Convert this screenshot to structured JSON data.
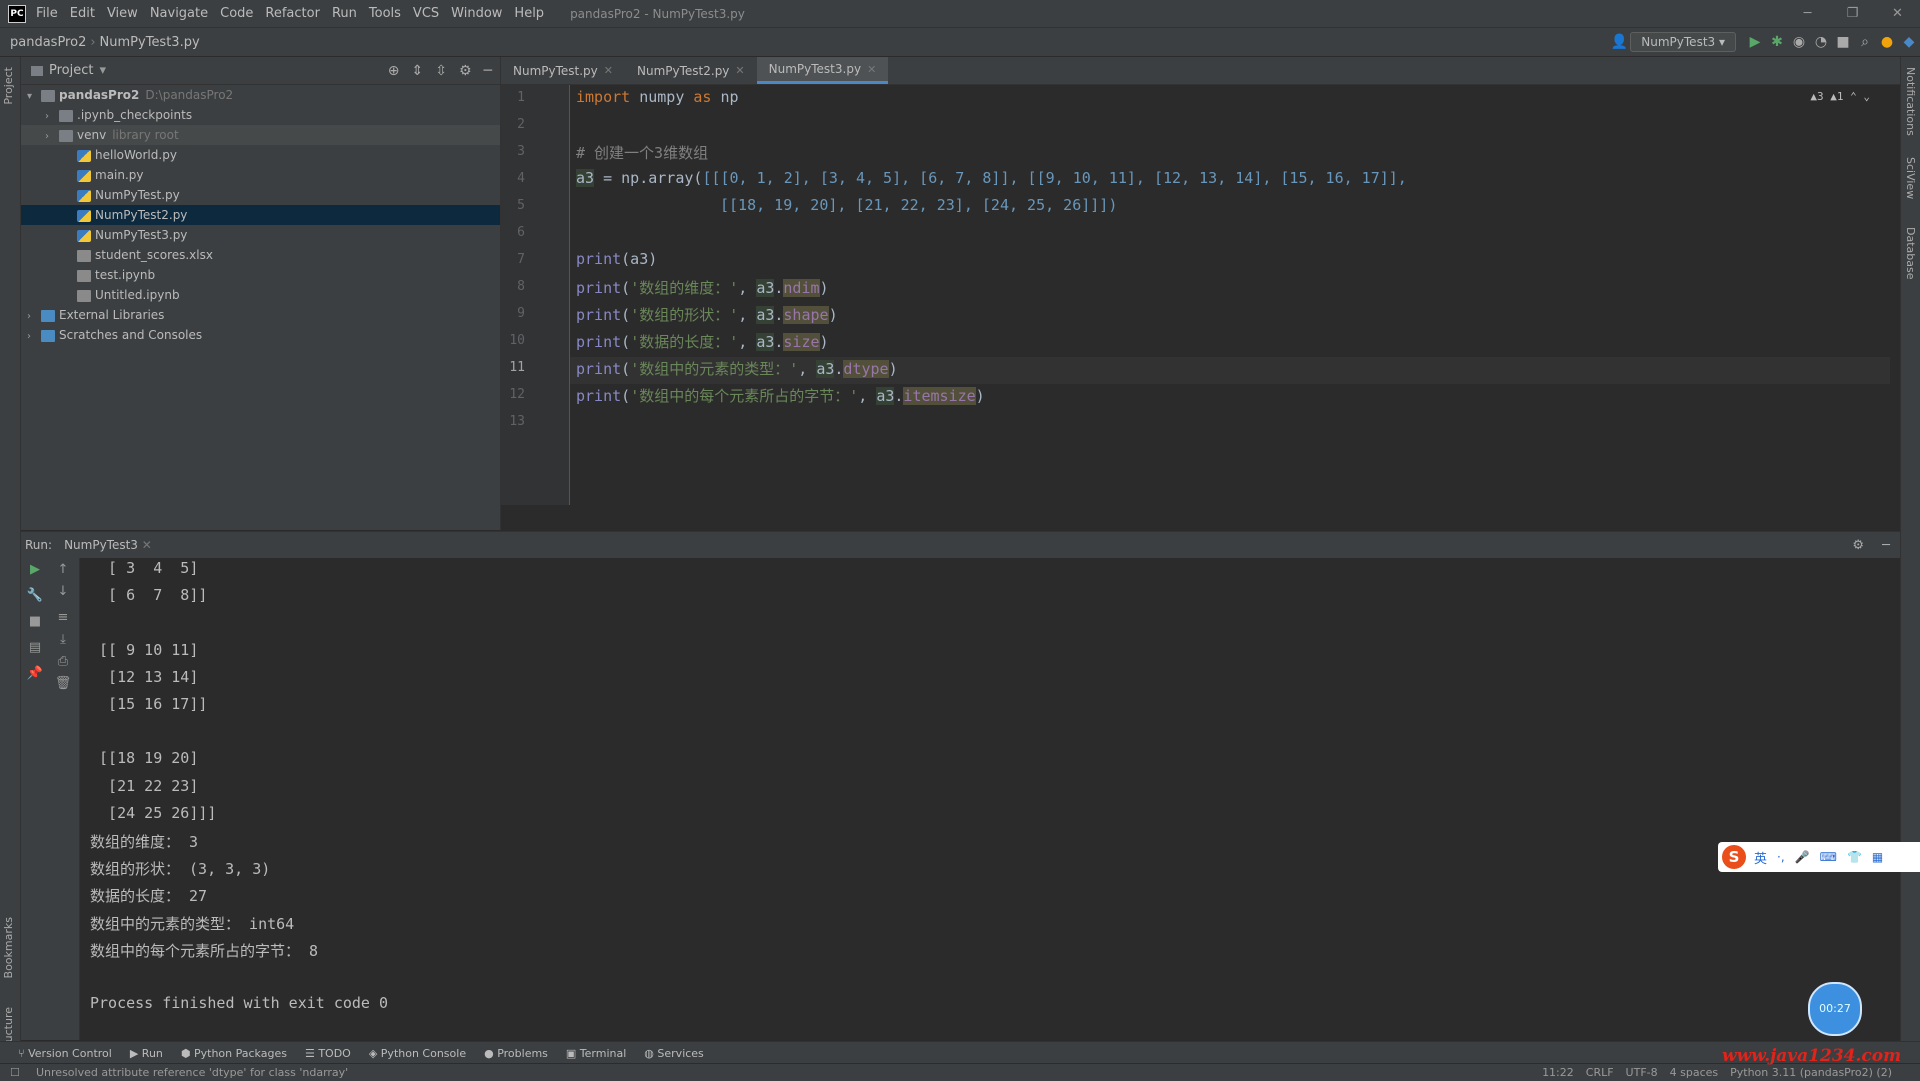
{
  "menu": {
    "items": [
      "File",
      "Edit",
      "View",
      "Navigate",
      "Code",
      "Refactor",
      "Run",
      "Tools",
      "VCS",
      "Window",
      "Help"
    ],
    "title": "pandasPro2 - NumPyTest3.py"
  },
  "nav": {
    "project": "pandasPro2",
    "file": "NumPyTest3.py",
    "run_config": "NumPyTest3"
  },
  "project_panel": {
    "title": "Project",
    "tree": [
      {
        "label": "pandasPro2",
        "extra": "D:\\pandasPro2",
        "indent": 0,
        "arrow": "▾",
        "icon": "folder"
      },
      {
        "label": ".ipynb_checkpoints",
        "indent": 1,
        "arrow": "›",
        "icon": "folder"
      },
      {
        "label": "venv",
        "extra": "library root",
        "indent": 1,
        "arrow": "›",
        "icon": "folder",
        "state": "hl"
      },
      {
        "label": "helloWorld.py",
        "indent": 2,
        "icon": "py"
      },
      {
        "label": "main.py",
        "indent": 2,
        "icon": "py"
      },
      {
        "label": "NumPyTest.py",
        "indent": 2,
        "icon": "py"
      },
      {
        "label": "NumPyTest2.py",
        "indent": 2,
        "icon": "py",
        "state": "sel"
      },
      {
        "label": "NumPyTest3.py",
        "indent": 2,
        "icon": "py"
      },
      {
        "label": "student_scores.xlsx",
        "indent": 2,
        "icon": "file"
      },
      {
        "label": "test.ipynb",
        "indent": 2,
        "icon": "file"
      },
      {
        "label": "Untitled.ipynb",
        "indent": 2,
        "icon": "file"
      },
      {
        "label": "External Libraries",
        "indent": 0,
        "arrow": "›",
        "icon": "lib"
      },
      {
        "label": "Scratches and Consoles",
        "indent": 0,
        "arrow": "›",
        "icon": "lib"
      }
    ]
  },
  "editor": {
    "tabs": [
      {
        "label": "NumPyTest.py",
        "active": false
      },
      {
        "label": "NumPyTest2.py",
        "active": false
      },
      {
        "label": "NumPyTest3.py",
        "active": true
      }
    ],
    "line_numbers": [
      "1",
      "2",
      "3",
      "4",
      "5",
      "6",
      "7",
      "8",
      "9",
      "10",
      "11",
      "12",
      "13"
    ],
    "inspection": "▲3 ▲1 ⌃ ⌄",
    "code": {
      "l1_kw1": "import",
      "l1_mod": " numpy ",
      "l1_kw2": "as",
      "l1_alias": " np",
      "l3": "# 创建一个3维数组",
      "l4_var": "a3",
      "l4_eq": " = np.array(",
      "l4_data": "[[[0, 1, 2], [3, 4, 5], [6, 7, 8]], [[9, 10, 11], [12, 13, 14], [15, 16, 17]],",
      "l5": "[[18, 19, 20], [21, 22, 23], [24, 25, 26]]])",
      "l7_fn": "print",
      "l7_arg": "(a3)",
      "l8_fn": "print",
      "l8_str": "'数组的维度：'",
      "l8_var": "a3",
      "l8_attr": "ndim",
      "l9_fn": "print",
      "l9_str": "'数组的形状：'",
      "l9_var": "a3",
      "l9_attr": "shape",
      "l10_fn": "print",
      "l10_str": "'数据的长度：'",
      "l10_var": "a3",
      "l10_attr": "size",
      "l11_fn": "print",
      "l11_str": "'数组中的元素的类型：'",
      "l11_var": "a3",
      "l11_attr": "dtype",
      "l12_fn": "print",
      "l12_str": "'数组中的每个元素所占的字节：'",
      "l12_var": "a3",
      "l12_attr": "itemsize"
    }
  },
  "run_panel": {
    "label": "Run:",
    "tab": "NumPyTest3",
    "output": [
      "  [ 3  4  5]",
      "  [ 6  7  8]]",
      "",
      " [[ 9 10 11]",
      "  [12 13 14]",
      "  [15 16 17]]",
      "",
      " [[18 19 20]",
      "  [21 22 23]",
      "  [24 25 26]]]",
      "数组的维度： 3",
      "数组的形状： (3, 3, 3)",
      "数据的长度： 27",
      "数组中的元素的类型： int64",
      "数组中的每个元素所占的字节： 8",
      "",
      "Process finished with exit code 0"
    ]
  },
  "bottom_tools": [
    "Version Control",
    "Run",
    "Python Packages",
    "TODO",
    "Python Console",
    "Problems",
    "Terminal",
    "Services"
  ],
  "status": {
    "message": "Unresolved attribute reference 'dtype' for class 'ndarray'",
    "right": [
      "11:22",
      "CRLF",
      "UTF-8",
      "4 spaces",
      "Python 3.11 (pandasPro2) (2)"
    ]
  },
  "overlays": {
    "watermark": "www.java1234.com",
    "ime_mode": "英",
    "bubble": "00:27"
  },
  "colors": {
    "accent": "#4a88c7",
    "keyword": "#cc7832",
    "string": "#6a8759",
    "number": "#6897bb"
  }
}
